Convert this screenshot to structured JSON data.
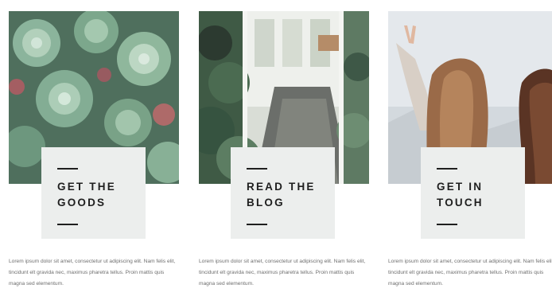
{
  "cards": [
    {
      "image": "succulents-photo",
      "title": "GET THE\nGOODS",
      "description": "Lorem ipsum dolor sit amet, consectetur ut adipiscing elit. Nam felis elit, tincidunt elt gravida nec, maximus pharetra tellus. Proin mattis quis magna sed elementum."
    },
    {
      "image": "greenhouse-photo",
      "title": "READ THE\nBLOG",
      "description": "Lorem ipsum dolor sit amet, consectetur ut adipiscing elit. Nam felis elit, tincidunt elt gravida nec, maximus pharetra tellus. Proin mattis quis magna sed elementum."
    },
    {
      "image": "friends-waving-photo",
      "title": "GET IN\nTOUCH",
      "description": "Lorem ipsum dolor sit amet, consectetur ut adipiscing elit. Nam felis elit, tincidunt elt gravida nec, maximus pharetra tellus. Proin mattis quis magna sed elementum."
    }
  ],
  "colors": {
    "label_box": "#eceeed",
    "title_text": "#1f1f1f",
    "body_text": "#6e6e6e"
  }
}
